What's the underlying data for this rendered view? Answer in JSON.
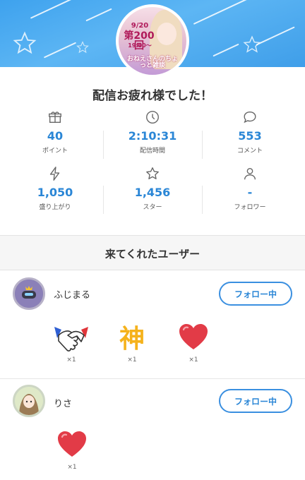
{
  "banner": {
    "avatar_date": "9/20",
    "avatar_episode": "第200回",
    "avatar_time": "19:00〜",
    "avatar_subtitle": "おねえさんのちょっと雑談"
  },
  "title": "配信お疲れ様でした！",
  "stats": [
    {
      "icon": "gift-icon",
      "value": "40",
      "label": "ポイント"
    },
    {
      "icon": "clock-icon",
      "value": "2:10:31",
      "label": "配信時間"
    },
    {
      "icon": "comment-icon",
      "value": "553",
      "label": "コメント"
    },
    {
      "icon": "lightning-icon",
      "value": "1,050",
      "label": "盛り上がり"
    },
    {
      "icon": "star-icon",
      "value": "1,456",
      "label": "スター"
    },
    {
      "icon": "person-icon",
      "value": "-",
      "label": "フォロワー"
    }
  ],
  "visitors_title": "来てくれたユーザー",
  "users": [
    {
      "name": "ふじまる",
      "follow_label": "フォロー中",
      "gifts": [
        {
          "icon": "handshake-gift-icon",
          "count": "×1"
        },
        {
          "icon": "kami-gift-icon",
          "glyph": "神",
          "count": "×1"
        },
        {
          "icon": "heart-gift-icon",
          "count": "×1"
        }
      ]
    },
    {
      "name": "りさ",
      "follow_label": "フォロー中",
      "gifts": [
        {
          "icon": "heart-gift-icon",
          "count": "×1"
        }
      ]
    }
  ],
  "colors": {
    "accent": "#2a86d6",
    "banner": "#4aaaf0",
    "heart": "#e23b47",
    "kami": "#f5b21c"
  }
}
